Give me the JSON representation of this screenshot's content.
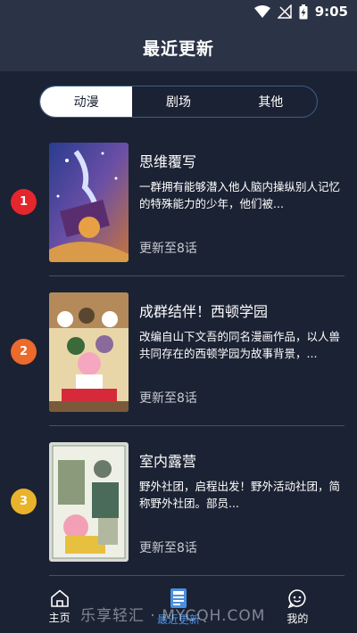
{
  "status": {
    "time": "9:05"
  },
  "header": {
    "title": "最近更新"
  },
  "tabs": [
    {
      "label": "动漫",
      "active": true
    },
    {
      "label": "剧场",
      "active": false
    },
    {
      "label": "其他",
      "active": false
    }
  ],
  "items": [
    {
      "rank": "1",
      "rank_color": "#e5262d",
      "title": "思维覆写",
      "desc": "一群拥有能够潜入他人脑内操纵别人记忆的特殊能力的少年，他们被...",
      "update": "更新至8话"
    },
    {
      "rank": "2",
      "rank_color": "#ec6a2b",
      "title": "成群结伴！西顿学园",
      "desc": "改编自山下文吾的同名漫画作品，以人兽共同存在的西顿学园为故事背景，...",
      "update": "更新至8话"
    },
    {
      "rank": "3",
      "rank_color": "#e9b32a",
      "title": "室内露营",
      "desc": "野外社团，启程出发！野外活动社团，简称野外社团。部员...",
      "update": "更新至8话"
    }
  ],
  "nav": [
    {
      "label": "主页",
      "icon": "home-icon",
      "active": false
    },
    {
      "label": "最近更新",
      "icon": "new-icon",
      "active": true
    },
    {
      "label": "我的",
      "icon": "chat-face-icon",
      "active": false
    }
  ],
  "watermark": "乐享轻汇 · MYCQH.COM"
}
